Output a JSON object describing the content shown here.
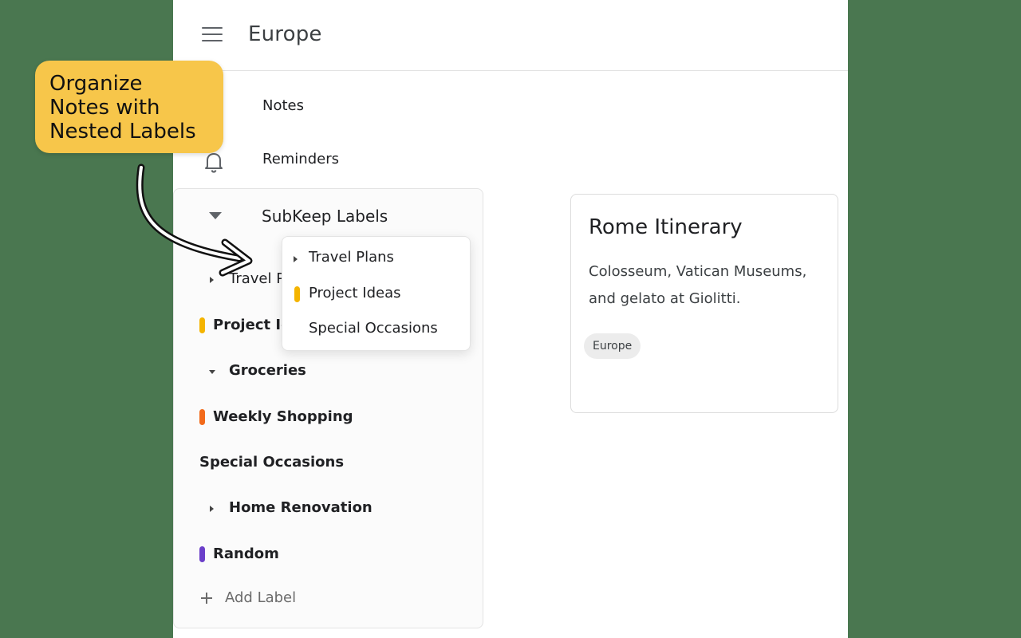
{
  "header": {
    "title": "Europe"
  },
  "nav": {
    "notes": "Notes",
    "reminders": "Reminders"
  },
  "labels_panel": {
    "title": "SubKeep Labels",
    "items": [
      {
        "text": "Travel P"
      },
      {
        "text": "Project Id",
        "color": "#f4b400"
      },
      {
        "text": "Groceries"
      },
      {
        "text": "Weekly Shopping",
        "color": "#f26a1b"
      },
      {
        "text": "Special Occasions"
      },
      {
        "text": "Home Renovation"
      },
      {
        "text": "Random",
        "color": "#6b3fc9"
      }
    ],
    "add_label": "Add Label"
  },
  "dropdown": {
    "items": [
      {
        "text": "Travel Plans"
      },
      {
        "text": "Project Ideas",
        "color": "#f4b400"
      },
      {
        "text": "Special Occasions"
      }
    ]
  },
  "note": {
    "title": "Rome Itinerary",
    "body": "Colosseum, Vatican Museums, and gelato at Giolitti.",
    "chip": "Europe"
  },
  "callout": {
    "lines": [
      "Organize",
      "Notes with",
      "Nested Labels"
    ]
  },
  "colors": {
    "background": "#4a7750",
    "callout": "#f7c64a"
  }
}
